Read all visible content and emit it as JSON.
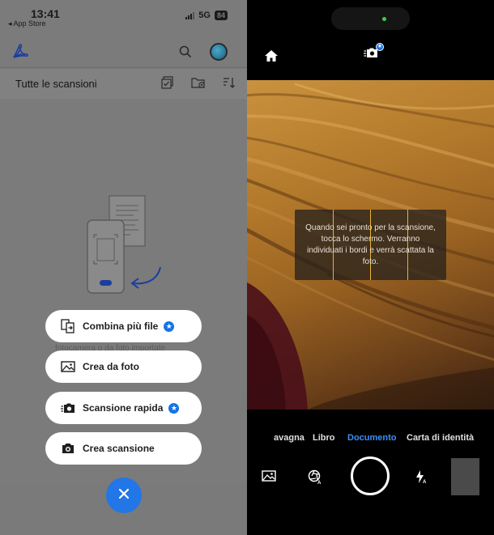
{
  "left_screen": {
    "status_bar": {
      "time": "13:41",
      "back_label": "◂ App Store",
      "network": "5G",
      "battery": "84"
    },
    "app_bar": {
      "logo_icon": "acrobat-logo-icon",
      "search_icon": "search-icon",
      "avatar_icon": "profile-avatar-icon"
    },
    "title_bar": {
      "title": "Tutte le scansioni",
      "icons": [
        "select-icon",
        "new-folder-icon",
        "sort-icon"
      ]
    },
    "background_text": "fotocamera o da foto importate",
    "actions": [
      {
        "label": "Combina più file",
        "icon": "combine-files-icon",
        "premium": true
      },
      {
        "label": "Crea da foto",
        "icon": "image-icon",
        "premium": false
      },
      {
        "label": "Scansione rapida",
        "icon": "quick-scan-camera-icon",
        "premium": true
      },
      {
        "label": "Crea scansione",
        "icon": "camera-icon",
        "premium": false
      }
    ],
    "close_button_icon": "close-icon",
    "colors": {
      "accent": "#2276e6",
      "overlay": "#7b7b7b"
    }
  },
  "right_screen": {
    "top_bar": {
      "home_icon": "home-icon",
      "mode_icon": "quick-scan-camera-icon"
    },
    "guide_text": "Quando sei pronto per la scansione, tocca lo schermo. Verranno individuati i bordi e verrà scattata la foto.",
    "modes": [
      {
        "label": "avagna",
        "active": false
      },
      {
        "label": "Libro",
        "active": false
      },
      {
        "label": "Documento",
        "active": true
      },
      {
        "label": "Carta di identità",
        "active": false
      }
    ],
    "controls": {
      "gallery_icon": "gallery-icon",
      "filter_icon": "auto-filter-icon",
      "shutter_icon": "shutter-button",
      "flash_icon": "flash-auto-icon"
    },
    "colors": {
      "active_mode": "#3d8ff5",
      "guide_border": "#e6b431"
    }
  }
}
